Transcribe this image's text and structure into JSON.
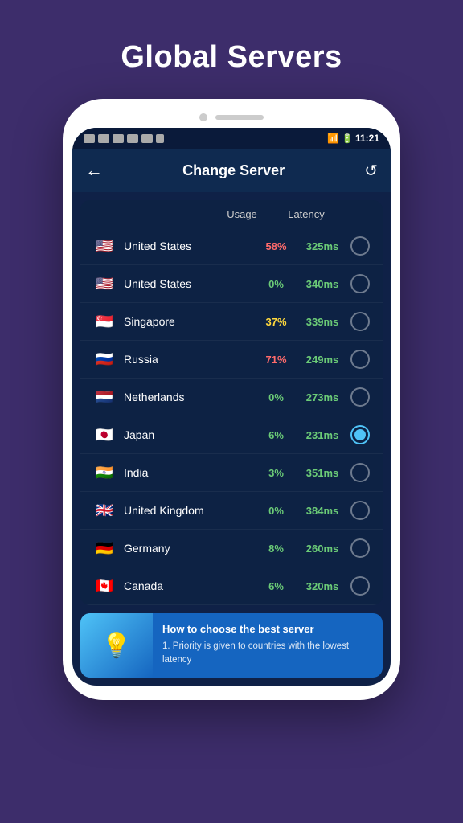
{
  "page": {
    "title": "Global Servers",
    "background": "#3d2d6b"
  },
  "statusBar": {
    "time": "11:21",
    "icons": [
      "wifi",
      "signal",
      "battery"
    ]
  },
  "header": {
    "back_label": "←",
    "title": "Change Server",
    "refresh_label": "↺"
  },
  "table": {
    "col_usage": "Usage",
    "col_latency": "Latency"
  },
  "servers": [
    {
      "id": 1,
      "country": "United States",
      "flag": "🇺🇸",
      "flag_class": "flag-us",
      "usage": "58%",
      "usage_class": "high",
      "latency": "325ms",
      "selected": false
    },
    {
      "id": 2,
      "country": "United States",
      "flag": "🇺🇸",
      "flag_class": "flag-us",
      "usage": "0%",
      "usage_class": "zero",
      "latency": "340ms",
      "selected": false
    },
    {
      "id": 3,
      "country": "Singapore",
      "flag": "🇸🇬",
      "flag_class": "flag-sg",
      "usage": "37%",
      "usage_class": "medium",
      "latency": "339ms",
      "selected": false
    },
    {
      "id": 4,
      "country": "Russia",
      "flag": "🇷🇺",
      "flag_class": "flag-ru",
      "usage": "71%",
      "usage_class": "high",
      "latency": "249ms",
      "selected": false
    },
    {
      "id": 5,
      "country": "Netherlands",
      "flag": "🇳🇱",
      "flag_class": "flag-nl",
      "usage": "0%",
      "usage_class": "zero",
      "latency": "273ms",
      "selected": false
    },
    {
      "id": 6,
      "country": "Japan",
      "flag": "🇯🇵",
      "flag_class": "flag-jp",
      "usage": "6%",
      "usage_class": "low",
      "latency": "231ms",
      "selected": true
    },
    {
      "id": 7,
      "country": "India",
      "flag": "🇮🇳",
      "flag_class": "flag-in",
      "usage": "3%",
      "usage_class": "low",
      "latency": "351ms",
      "selected": false
    },
    {
      "id": 8,
      "country": "United Kingdom",
      "flag": "🇬🇧",
      "flag_class": "flag-uk",
      "usage": "0%",
      "usage_class": "zero",
      "latency": "384ms",
      "selected": false
    },
    {
      "id": 9,
      "country": "Germany",
      "flag": "🇩🇪",
      "flag_class": "flag-de",
      "usage": "8%",
      "usage_class": "low",
      "latency": "260ms",
      "selected": false
    },
    {
      "id": 10,
      "country": "Canada",
      "flag": "🇨🇦",
      "flag_class": "flag-ca",
      "usage": "6%",
      "usage_class": "low",
      "latency": "320ms",
      "selected": false
    }
  ],
  "tip": {
    "title": "How to choose the best server",
    "text": "1. Priority is given to countries with the lowest latency",
    "icon": "💡"
  }
}
